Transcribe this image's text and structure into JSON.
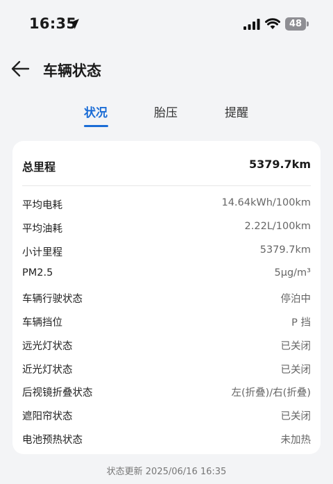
{
  "status_bar": {
    "time": "16:35",
    "battery": "48",
    "icons": [
      "location-arrow-icon",
      "cellular-signal-icon",
      "wifi-icon",
      "battery-icon"
    ]
  },
  "header": {
    "back_icon": "arrow-left-icon",
    "title": "车辆状态"
  },
  "tabs": [
    {
      "label": "状况",
      "active": true
    },
    {
      "label": "胎压",
      "active": false
    },
    {
      "label": "提醒",
      "active": false
    }
  ],
  "summary": {
    "label": "总里程",
    "value": "5379.7km"
  },
  "rows": [
    {
      "label": "平均电耗",
      "value": "14.64kWh/100km"
    },
    {
      "label": "平均油耗",
      "value": "2.22L/100km"
    },
    {
      "label": "小计里程",
      "value": "5379.7km"
    },
    {
      "label": "PM2.5",
      "value": "5μg/m³"
    },
    {
      "label": "车辆行驶状态",
      "value": "停泊中"
    },
    {
      "label": "车辆挡位",
      "value": "P 挡"
    },
    {
      "label": "远光灯状态",
      "value": "已关闭"
    },
    {
      "label": "近光灯状态",
      "value": "已关闭"
    },
    {
      "label": "后视镜折叠状态",
      "value": "左(折叠)/右(折叠)"
    },
    {
      "label": "遮阳帘状态",
      "value": "已关闭"
    },
    {
      "label": "电池预热状态",
      "value": "未加热"
    }
  ],
  "footer": {
    "update_text": "状态更新 2025/06/16 16:35"
  },
  "colors": {
    "accent": "#1a6cd6",
    "background": "#f3f4f6",
    "card": "#ffffff"
  }
}
